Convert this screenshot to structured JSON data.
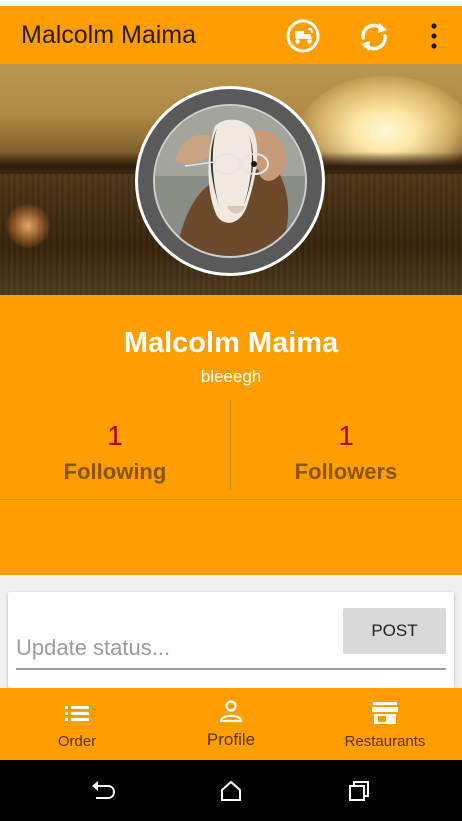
{
  "app_bar": {
    "title": "Malcolm Maima",
    "actions": [
      {
        "icon": "delivery-scooter-icon"
      },
      {
        "icon": "sync-icon"
      },
      {
        "icon": "more-vert-icon"
      }
    ]
  },
  "profile": {
    "name": "Malcolm Maima",
    "username": "bleeegh",
    "following_count": "1",
    "following_label": "Following",
    "followers_count": "1",
    "followers_label": "Followers"
  },
  "status": {
    "placeholder": "Update status...",
    "post_label": "POST"
  },
  "bottom_nav": {
    "items": [
      {
        "label": "Order",
        "icon": "list-icon"
      },
      {
        "label": "Profile",
        "icon": "person-icon",
        "active": true
      },
      {
        "label": "Restaurants",
        "icon": "store-icon"
      }
    ]
  },
  "system_nav": {
    "icons": [
      "back-icon",
      "home-icon",
      "recents-icon"
    ]
  },
  "colors": {
    "primary": "#ff9e00",
    "count": "#b50000",
    "stat_label": "#8a5400"
  }
}
